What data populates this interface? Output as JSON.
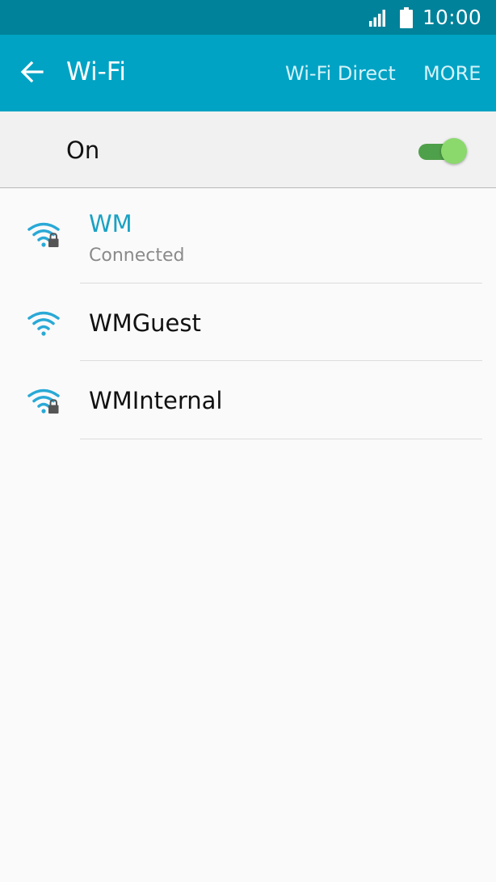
{
  "status_bar": {
    "time": "10:00",
    "signal_icon": "cell-signal-icon",
    "battery_icon": "battery-icon"
  },
  "app_bar": {
    "back_icon": "arrow-back-icon",
    "title": "Wi-Fi",
    "wifi_direct_label": "Wi-Fi Direct",
    "more_label": "MORE",
    "color": "#00a3c4"
  },
  "wifi_toggle": {
    "label": "On",
    "state": true,
    "color": "#4fa04a"
  },
  "networks": [
    {
      "name": "WM",
      "status": "Connected",
      "secured": true,
      "connected": true
    },
    {
      "name": "WMGuest",
      "status": "",
      "secured": false,
      "connected": false
    },
    {
      "name": "WMInternal",
      "status": "",
      "secured": true,
      "connected": false
    }
  ],
  "colors": {
    "status_bar": "#00829a",
    "accent": "#1aa1c4",
    "wifi_icon": "#29a9d6"
  }
}
